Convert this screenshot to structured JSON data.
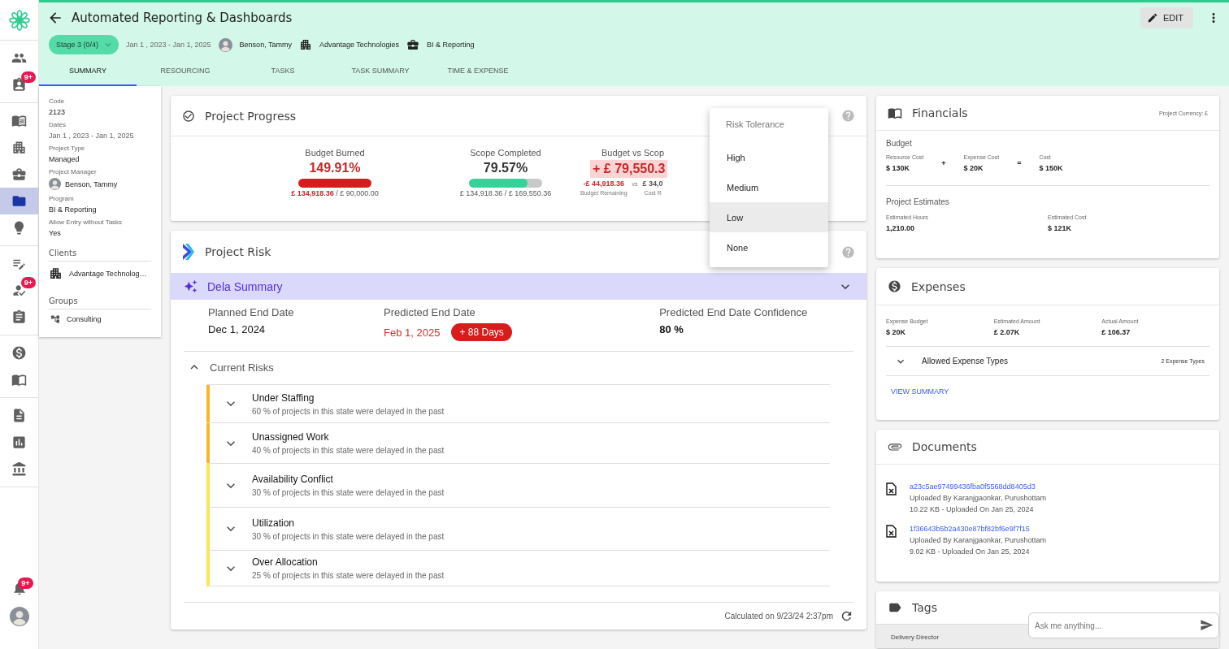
{
  "nav_rail": {
    "groups": [
      {
        "items": [
          {
            "selected": false
          },
          {
            "selected": false,
            "badge": "9+"
          }
        ]
      },
      {
        "items": [
          {
            "selected": false
          },
          {
            "selected": false
          },
          {
            "selected": false
          },
          {
            "selected": true
          },
          {
            "selected": false
          }
        ]
      },
      {
        "items": [
          {
            "selected": false
          },
          {
            "selected": false,
            "badge": "9+"
          },
          {
            "selected": false
          }
        ]
      },
      {
        "items": [
          {
            "selected": false
          },
          {
            "selected": false
          }
        ]
      },
      {
        "items": [
          {
            "selected": false
          },
          {
            "selected": false
          },
          {
            "selected": false
          }
        ]
      }
    ],
    "notifications_badge": "9+"
  },
  "header": {
    "title": "Automated Reporting & Dashboards",
    "stage": "Stage 3 (0/4)",
    "dates": "Jan 1 , 2023 - Jan 1, 2025",
    "manager": "Benson, Tammy",
    "client": "Advantage Technologies",
    "program": "BI & Reporting",
    "edit_button": "EDIT",
    "tabs": [
      {
        "label": "SUMMARY",
        "selected": true
      },
      {
        "label": "RESOURCING",
        "selected": false
      },
      {
        "label": "TASKS",
        "selected": false
      },
      {
        "label": "TASK SUMMARY",
        "selected": false
      },
      {
        "label": "TIME & EXPENSE",
        "selected": false
      }
    ]
  },
  "details": {
    "fields": [
      {
        "label": "Code",
        "value": "2123",
        "kind": "text"
      },
      {
        "label": "Dates",
        "value": "Jan 1 , 2023 - Jan 1, 2025",
        "kind": "muted"
      },
      {
        "label": "Project Type",
        "value": "Managed",
        "kind": "text"
      },
      {
        "label": "Project Manager",
        "value": "Benson, Tammy",
        "kind": "person"
      },
      {
        "label": "Program",
        "value": "BI & Reporting",
        "kind": "text"
      },
      {
        "label": "Allow Entry without Tasks",
        "value": "Yes",
        "kind": "text"
      }
    ],
    "clients": {
      "title": "Clients",
      "items": [
        "Advantage Technolog…"
      ]
    },
    "groups": {
      "title": "Groups",
      "items": [
        "Consulting"
      ]
    }
  },
  "progress": {
    "title": "Project Progress",
    "metrics": [
      {
        "kind": "bar",
        "title": "Budget Burned",
        "value": "149.91%",
        "alert": true,
        "level": 1,
        "spent": "£ 134,918.36",
        "total": "/ £ 90,000.00"
      },
      {
        "kind": "bar",
        "title": "Scope Completed",
        "value": "79.57%",
        "alert": false,
        "level": 0.7957,
        "spent": "£ 134,918.36",
        "total": "/ £ 169,550.36"
      },
      {
        "kind": "delta",
        "title": "Budget vs Scop",
        "value": "+ £ 79,550.3",
        "left": {
          "amount": "-£ 44,918.36",
          "caption": "Budget Remaining"
        },
        "separator": "vs",
        "right": {
          "amount": "£ 34,0",
          "caption": "Cost R"
        }
      }
    ]
  },
  "risk_tolerance_menu": {
    "title": "Risk Tolerance",
    "options": [
      {
        "label": "High",
        "selected": false
      },
      {
        "label": "Medium",
        "selected": false
      },
      {
        "label": "Low",
        "selected": true
      },
      {
        "label": "None",
        "selected": false
      }
    ]
  },
  "risk": {
    "title": "Project Risk",
    "summary": {
      "title": "Dela Summary",
      "expanded": false
    },
    "planned": {
      "label": "Planned End Date",
      "value": "Dec 1, 2024"
    },
    "predicted": {
      "label": "Predicted End Date",
      "value": "Feb 1, 2025",
      "badge": "+ 88 Days"
    },
    "confidence": {
      "label": "Predicted End Date Confidence",
      "value": "80 %"
    },
    "current_risks": {
      "title": "Current Risks",
      "expanded": true,
      "items": [
        {
          "name": "Under Staffing",
          "note": "60 % of projects in this state were delayed in the past",
          "color": "#fbb424",
          "expanded": false
        },
        {
          "name": "Unassigned Work",
          "note": "40 % of projects in this state were delayed in the past",
          "color": "#fbb424",
          "expanded": false
        },
        {
          "name": "Availability Conflict",
          "note": "30 % of projects in this state were delayed in the past",
          "color": "#fde74c",
          "expanded": false
        },
        {
          "name": "Utilization",
          "note": "30 % of projects in this state were delayed in the past",
          "color": "#fde74c",
          "expanded": false
        },
        {
          "name": "Over Allocation",
          "note": "25 % of projects in this state were delayed in the past",
          "color": "#fde74c",
          "expanded": false
        }
      ]
    },
    "calculated": "Calculated on 9/23/24 2:37pm"
  },
  "financials": {
    "title": "Financials",
    "currency": "Project Currency: £",
    "budget": {
      "title": "Budget",
      "items": [
        {
          "kind": "figure",
          "label": "Resource Cost",
          "value": "$ 130K"
        },
        {
          "kind": "operator",
          "value": "+"
        },
        {
          "kind": "figure",
          "label": "Expense Cost",
          "value": "$ 20K"
        },
        {
          "kind": "operator",
          "value": "="
        },
        {
          "kind": "figure",
          "label": "Cost",
          "value": "$ 150K"
        }
      ]
    },
    "estimates": {
      "title": "Project Estimates",
      "items": [
        {
          "label": "Estimated Hours",
          "value": "1,210.00"
        },
        {
          "label": "Estimated Cost",
          "value": "$ 121K"
        }
      ]
    }
  },
  "expenses": {
    "title": "Expenses",
    "figures": [
      {
        "label": "Expense Budget",
        "value": "$ 20K"
      },
      {
        "label": "Estimated Amount",
        "value": "£ 2.07K"
      },
      {
        "label": "Actual Amount",
        "value": "£ 106.37"
      }
    ],
    "allowed_types": {
      "label": "Allowed Expense Types",
      "count": "2 Expense Types",
      "expanded": false
    },
    "link": "VIEW SUMMARY"
  },
  "documents": {
    "title": "Documents",
    "items": [
      {
        "name": "a23c5ae97499436fba0f5568dd8405d3",
        "uploaded_by": "Uploaded By Karanjgaonkar, Purushottam",
        "meta": "10.22 KB - Uploaded On Jan 25, 2024"
      },
      {
        "name": "1f36643b5b2a430e87bf82bf6e9f7f15",
        "uploaded_by": "Uploaded By Karanjgaonkar, Purushottam",
        "meta": "9.02 KB - Uploaded On Jan 25, 2024"
      }
    ]
  },
  "tags": {
    "title": "Tags",
    "row": "Delivery Director"
  },
  "chat": {
    "placeholder": "Ask me anything..."
  }
}
